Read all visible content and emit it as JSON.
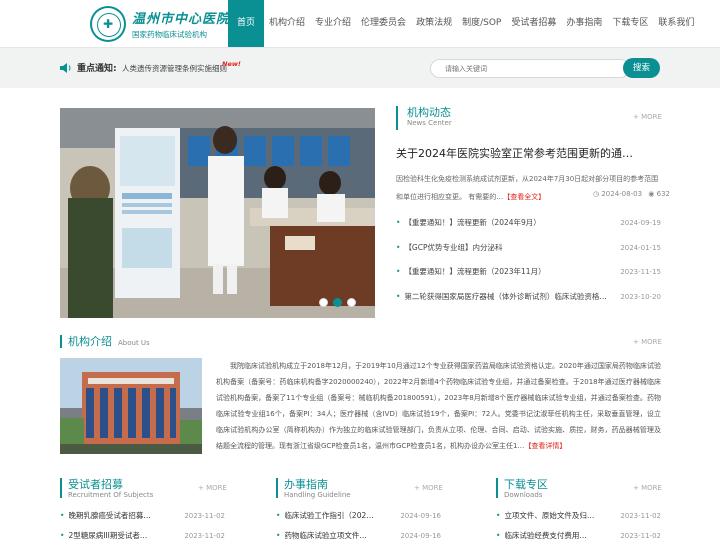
{
  "brand": {
    "name_line1": "温州市中心医院",
    "name_line2": "国家药物临床试验机构"
  },
  "nav": [
    {
      "label": "首页",
      "active": true
    },
    {
      "label": "机构介绍"
    },
    {
      "label": "专业介绍"
    },
    {
      "label": "伦理委员会"
    },
    {
      "label": "政策法规"
    },
    {
      "label": "制度/SOP"
    },
    {
      "label": "受试者招募"
    },
    {
      "label": "办事指南"
    },
    {
      "label": "下载专区"
    },
    {
      "label": "联系我们"
    }
  ],
  "notice": {
    "label": "重点通知:",
    "text": "人类遗传资源管理条例实施细则",
    "badge": "New!"
  },
  "search": {
    "placeholder": "请输入关键词",
    "button": "搜索"
  },
  "news": {
    "title": "机构动态",
    "subtitle": "News Center",
    "more": "+ MORE",
    "headline": "关于2024年医院实验室正常参考范围更新的通…",
    "summary": "因检验科生化免疫检测系统成试剂更新，从2024年7月30日起对部分项目的参考范围和单位进行相应变更。 有需要的…",
    "summary_link": "【查看全文】",
    "date": "2024-08-03",
    "views": "632",
    "items": [
      {
        "title": "【重要通知！】流程更新（2024年9月）",
        "date": "2024-09-19"
      },
      {
        "title": "【GCP优势专业组】内分泌科",
        "date": "2024-01-15"
      },
      {
        "title": "【重要通知！】流程更新（2023年11月）",
        "date": "2023-11-15"
      },
      {
        "title": "第二轮获得国家局医疗器械（体外诊断试剂）临床试验资格…",
        "date": "2023-10-20"
      }
    ]
  },
  "about": {
    "title": "机构介绍",
    "subtitle": "About Us",
    "more": "+ MORE",
    "text": "我院临床试验机构成立于2018年12月，于2019年10月通过12个专业获得国家药监局临床试验资格认定。2020年通过国家局药物临床试验机构备案（备案号：药临床机构备字2020000240），2022年2月新增4个药物临床试验专业组，并通过备案检查。于2018年通过医疗器械临床试验机构备案，备案了11个专业组（备案号：械临机构备201800591），2023年8月新增8个医疗器械临床试验专业组，并通过备案检查。药物临床试验专业组16个，备案PI：34人；医疗器械（含IVD）临床试验19个，备案PI：72人。党委书记沈淑菲任机构主任，采取垂直管理，设立临床试验机构办公室（简称机构办）作为独立的临床试验管理部门，负责从立项、伦理、合同、启动、试验实施、质控，财务，药品器械管理及结题全流程的管理。现有浙江省级GCP检查员1名，温州市GCP检查员1名，机构办设办公室主任1…",
    "link": "【查看详情】"
  },
  "recruit": {
    "title": "受试者招募",
    "subtitle": "Recruitment Of Subjects",
    "more": "+ MORE",
    "items": [
      {
        "title": "晚期乳腺癌受试者招募…",
        "date": "2023-11-02"
      },
      {
        "title": "2型糖尿病III期受试者…",
        "date": "2023-11-02"
      }
    ]
  },
  "guide": {
    "title": "办事指南",
    "subtitle": "Handling Guideline",
    "more": "+ MORE",
    "items": [
      {
        "title": "临床试验工作指引（202…",
        "date": "2024-09-16"
      },
      {
        "title": "药物临床试验立项文件…",
        "date": "2024-09-16"
      }
    ]
  },
  "download": {
    "title": "下载专区",
    "subtitle": "Downloads",
    "more": "+ MORE",
    "items": [
      {
        "title": "立项文件、原始文件及归…",
        "date": "2023-11-02"
      },
      {
        "title": "临床试验经费支付费用…",
        "date": "2023-11-02"
      }
    ]
  },
  "colors": {
    "accent": "#0a8f93",
    "highlight": "#e2231a",
    "bar_bg": "#f1f2f2"
  }
}
